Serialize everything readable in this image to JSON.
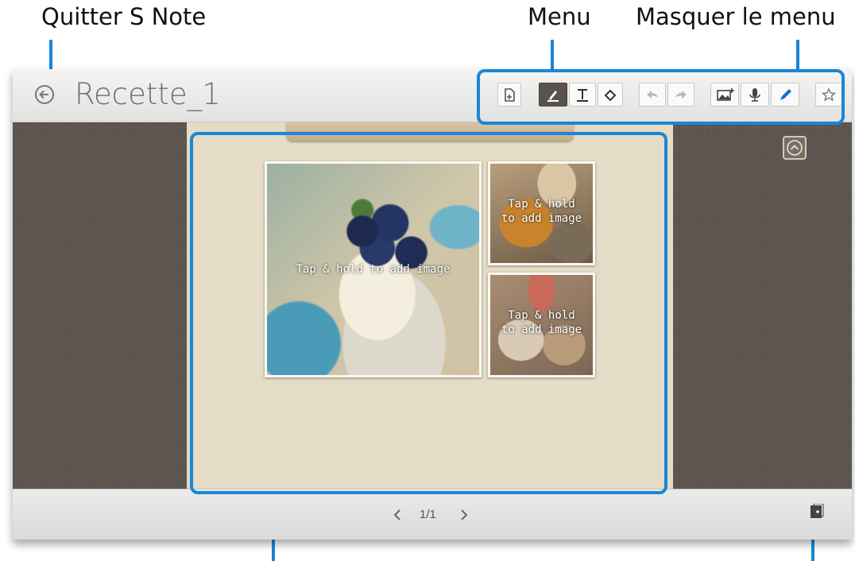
{
  "callouts": {
    "exit": "Quitter S Note",
    "menu": "Menu",
    "hide_menu": "Masquer le menu"
  },
  "header": {
    "back_icon": "back-arrow-icon",
    "title": "Recette_1"
  },
  "toolbar": [
    {
      "icon": "page-settings-icon",
      "active": false
    },
    {
      "icon": "pen-icon",
      "active": true
    },
    {
      "icon": "text-icon",
      "active": false
    },
    {
      "icon": "eraser-icon",
      "active": false
    },
    {
      "icon": "undo-icon",
      "active": false
    },
    {
      "icon": "redo-icon",
      "active": false
    },
    {
      "icon": "insert-image-icon",
      "active": false
    },
    {
      "icon": "microphone-icon",
      "active": false
    },
    {
      "icon": "pencil-icon",
      "active": false
    },
    {
      "icon": "star-icon",
      "active": false
    }
  ],
  "hide_menu_icon": "chevron-up-icon",
  "photos": [
    {
      "label": "Tap & hold to add image"
    },
    {
      "label": "Tap & hold to add image"
    },
    {
      "label": "Tap & hold to add image"
    }
  ],
  "pager": {
    "current": "1/1",
    "prev_icon": "chevron-left-icon",
    "next_icon": "chevron-right-icon"
  },
  "add_page_icon": "add-page-icon",
  "colors": {
    "accent": "#1a86d6",
    "background": "#5d554f",
    "note": "#e4dcc6",
    "active_tool": "#5a534d"
  }
}
